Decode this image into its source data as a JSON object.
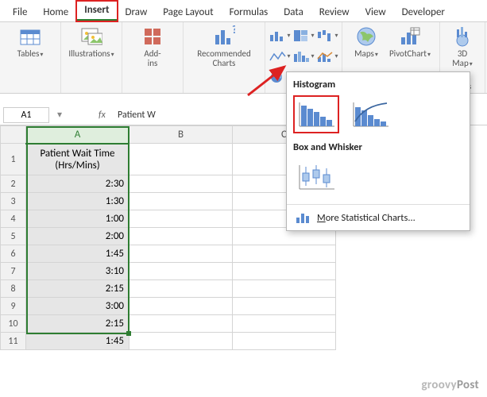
{
  "tabs": [
    "File",
    "Home",
    "Insert",
    "Draw",
    "Page Layout",
    "Formulas",
    "Data",
    "Review",
    "View",
    "Developer"
  ],
  "active_tab": "Insert",
  "ribbon": {
    "tables": "Tables",
    "illustrations": "Illustrations",
    "addins": "Add-\nins",
    "rec_charts": "Recommended\nCharts",
    "maps": "Maps",
    "pivotchart": "PivotChart",
    "map3d": "3D\nMap",
    "group_tours": "Tours"
  },
  "namebox": "A1",
  "formula_bar": "Patient W",
  "columns": [
    "A",
    "B",
    "C"
  ],
  "rows": [
    "1",
    "2",
    "3",
    "4",
    "5",
    "6",
    "7",
    "8",
    "9",
    "10",
    "11"
  ],
  "header_cell": "Patient Wait Time (Hrs/Mins)",
  "data_cells": [
    "2:30",
    "1:30",
    "1:00",
    "2:00",
    "1:45",
    "3:10",
    "2:15",
    "3:00",
    "2:15",
    "1:45"
  ],
  "dropdown": {
    "section1": "Histogram",
    "section2": "Box and Whisker",
    "more": "More Statistical Charts..."
  },
  "watermark_a": "groovy",
  "watermark_b": "Post"
}
